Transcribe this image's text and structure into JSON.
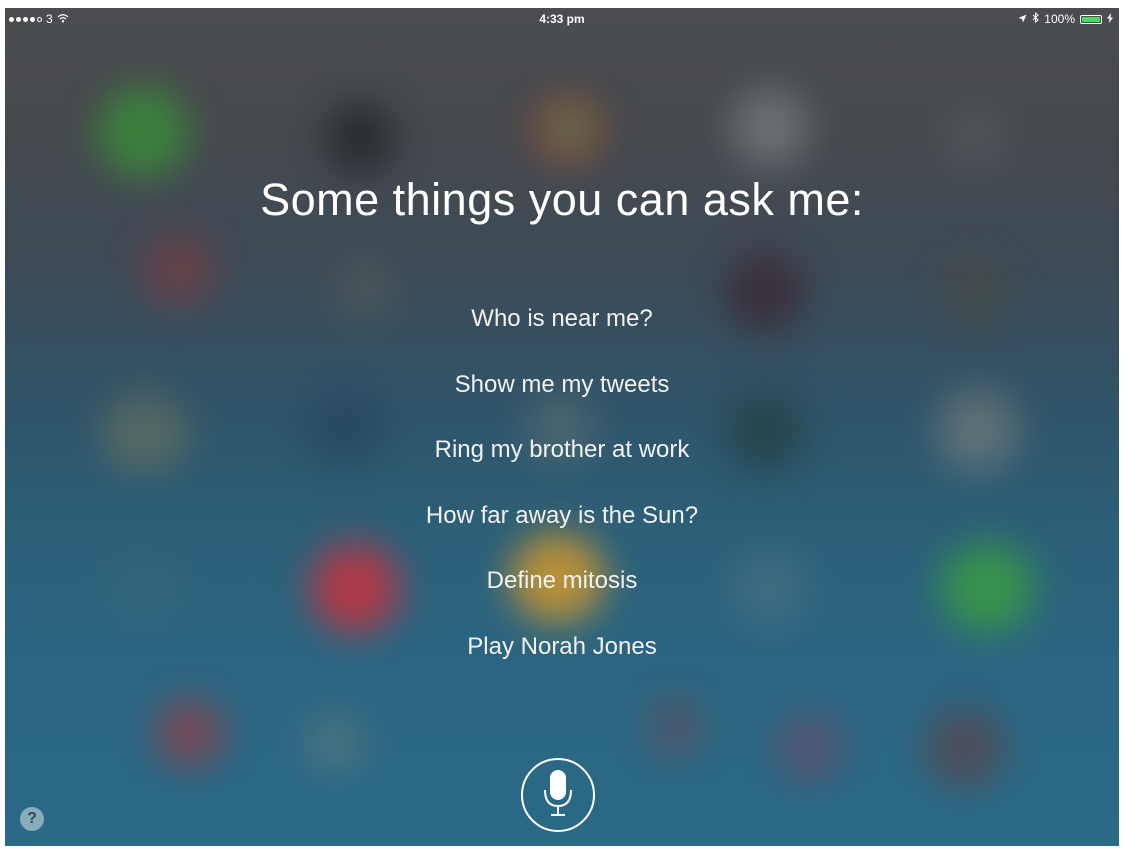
{
  "status_bar": {
    "carrier": "3",
    "time": "4:33 pm",
    "battery": "100%"
  },
  "siri": {
    "heading": "Some things you can ask me:",
    "suggestions": [
      "Who is near me?",
      "Show me my tweets",
      "Ring my brother at work",
      "How far away is the Sun?",
      "Define mitosis",
      "Play Norah Jones"
    ],
    "help_label": "?"
  },
  "colors": {
    "battery_fill": "#4cd964",
    "text": "#ffffff"
  },
  "icons": {
    "signal": "signal-dots-icon",
    "wifi": "wifi-icon",
    "location": "location-arrow-icon",
    "bluetooth": "bluetooth-icon",
    "battery": "battery-icon",
    "charging": "charging-bolt-icon",
    "mic": "microphone-icon",
    "help": "help-icon"
  }
}
